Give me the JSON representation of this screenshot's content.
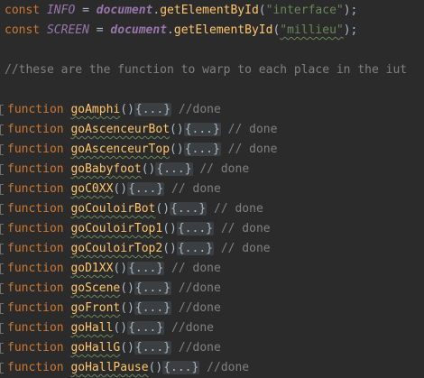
{
  "code": {
    "line1": {
      "keyword": "const",
      "name": "INFO",
      "op": " = ",
      "obj": "document",
      "dot": ".",
      "method": "getElementById",
      "open": "(",
      "arg": "\"interface\"",
      "close": ");"
    },
    "line2": {
      "keyword": "const",
      "name": "SCREEN",
      "op": " = ",
      "obj": "document",
      "dot": ".",
      "method": "getElementById",
      "open": "(",
      "arg": "\"millieu\"",
      "close": ");"
    },
    "comment": "//these are the function to warp to each place in the iut",
    "function_keyword": "function",
    "parens": "()",
    "folded_body": "{...}",
    "functions": [
      {
        "name": "goAmphi",
        "comment": " //done"
      },
      {
        "name": "goAscenceurBot",
        "comment": " // done"
      },
      {
        "name": "goAscenceurTop",
        "comment": " // done"
      },
      {
        "name": "goBabyfoot",
        "comment": " // done"
      },
      {
        "name": "goC0XX",
        "comment": " // done"
      },
      {
        "name": "goCouloirBot",
        "comment": " // done"
      },
      {
        "name": "goCouloirTop1",
        "comment": " // done"
      },
      {
        "name": "goCouloirTop2",
        "comment": " // done"
      },
      {
        "name": "goD1XX",
        "comment": " // done"
      },
      {
        "name": "goScene",
        "comment": " //done"
      },
      {
        "name": "goFront",
        "comment": " //done"
      },
      {
        "name": "goHall",
        "comment": " //done"
      },
      {
        "name": "goHallG",
        "comment": " //done"
      },
      {
        "name": "goHallPause",
        "comment": " //done"
      }
    ]
  },
  "colors": {
    "background": "#2b2b2b",
    "keyword": "#cc7832",
    "constant": "#9876aa",
    "function_name": "#ffc66d",
    "string": "#6a8759",
    "comment": "#808080",
    "fold_background": "#3b3f41"
  }
}
